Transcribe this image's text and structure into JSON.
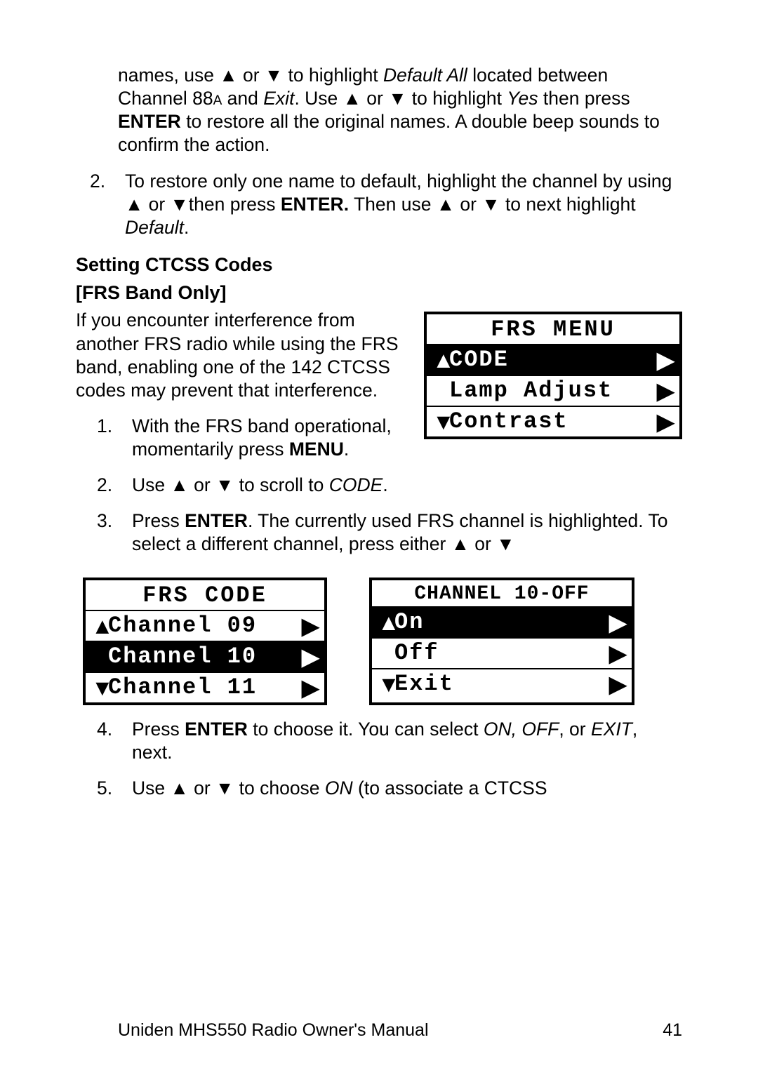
{
  "para1_parts": {
    "a": "names, use ",
    "up1": "▲",
    "or1": " or ",
    "dn1": "▼",
    "b": " to highlight ",
    "defall": "Default All",
    "c": " located between Channel 88",
    "asmall": "A",
    "d": " and ",
    "exit": "Exit",
    "e": ". Use ",
    "up2": "▲",
    "or2": " or ",
    "dn2": "▼",
    "f": " to highlight ",
    "yes": "Yes",
    "g": " then press ",
    "enter": "ENTER",
    "h": " to restore all the original names. A double beep sounds to confirm the action."
  },
  "item2": {
    "num": "2.",
    "a": "To restore only one name to default, highlight the channel by using ",
    "up": "▲",
    "or": " or ",
    "dn": "▼",
    "b": "then press ",
    "enter": "ENTER.",
    "c": " Then use ",
    "up2": "▲",
    "or2": " or ",
    "dn2": "▼",
    "d": " to next highlight ",
    "def": "Default",
    "e": "."
  },
  "heading1": "Setting CTCSS Codes",
  "heading2": "[FRS Band Only]",
  "intro": "If you encounter interference from another FRS radio while using the FRS band, enabling one of the 142 CTCSS codes may prevent that interference.",
  "steps": {
    "s1": {
      "num": "1.",
      "a": "With the FRS band operational, momentarily press ",
      "menu": "MENU",
      "b": "."
    },
    "s2": {
      "num": "2.",
      "a": "Use ",
      "up": "▲",
      "or": " or ",
      "dn": "▼",
      "b": " to scroll to ",
      "code": "CODE",
      "c": "."
    },
    "s3": {
      "num": "3.",
      "a": "Press ",
      "enter": "ENTER",
      "b": ". The currently used FRS channel is highlight­ed. To select a different channel, press either ",
      "up": "▲",
      "or": " or ",
      "dn": "▼"
    },
    "s4": {
      "num": "4.",
      "a": "Press ",
      "enter": "ENTER",
      "b": " to choose it. You can select ",
      "on": "ON, OFF",
      "c": ", or ",
      "exit": "EXIT",
      "d": ", next."
    },
    "s5": {
      "num": "5.",
      "a": "Use ",
      "up": "▲",
      "or": " or ",
      "dn": "▼",
      "b": " to choose ",
      "on": "ON",
      "c": " (to associate a CTCSS"
    }
  },
  "screen1": {
    "title": "FRS MENU",
    "r1": {
      "up": "▲",
      "text": "CODE",
      "right": "▶"
    },
    "r2": {
      "up": "",
      "text": "Lamp Adjust",
      "right": "▶"
    },
    "r3": {
      "up": "▼",
      "text": "Contrast",
      "right": "▶"
    }
  },
  "screen2": {
    "title": "FRS CODE",
    "r1": {
      "up": "▲",
      "text": "Channel 09",
      "right": "▶"
    },
    "r2": {
      "up": "",
      "text": "Channel 10",
      "right": "▶"
    },
    "r3": {
      "up": "▼",
      "text": "Channel 11",
      "right": "▶"
    }
  },
  "screen3": {
    "title": "CHANNEL 10-OFF",
    "r1": {
      "up": "▲",
      "text": "On",
      "right": "▶"
    },
    "r2": {
      "up": "",
      "text": "Off",
      "right": "▶"
    },
    "r3": {
      "up": "▼",
      "text": "Exit",
      "right": "▶"
    }
  },
  "footer": {
    "title": "Uniden MHS550 Radio Owner's Manual",
    "page": "41"
  }
}
